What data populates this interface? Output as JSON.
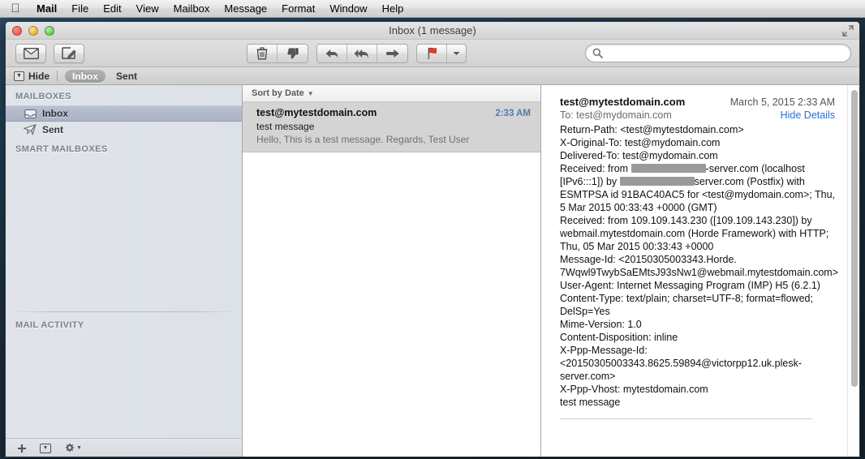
{
  "menubar": {
    "apple_icon": "apple-logo-icon",
    "items": [
      {
        "label": "Mail",
        "app": true
      },
      {
        "label": "File"
      },
      {
        "label": "Edit"
      },
      {
        "label": "View"
      },
      {
        "label": "Mailbox"
      },
      {
        "label": "Message"
      },
      {
        "label": "Format"
      },
      {
        "label": "Window"
      },
      {
        "label": "Help"
      }
    ]
  },
  "window": {
    "title": "Inbox (1 message)",
    "traffic_lights": [
      "close-button",
      "minimize-button",
      "zoom-button"
    ],
    "fullscreen_icon": "fullscreen-icon"
  },
  "toolbar": {
    "get_mail_icon": "envelope-icon",
    "compose_icon": "compose-icon",
    "delete_icon": "trash-icon",
    "junk_icon": "thumbs-down-icon",
    "reply_icon": "reply-arrow-icon",
    "reply_all_icon": "reply-all-arrow-icon",
    "forward_icon": "forward-arrow-icon",
    "flag_icon": "flag-icon",
    "flag_caret_icon": "caret-down-icon",
    "search": {
      "icon": "search-icon",
      "value": "",
      "placeholder": ""
    }
  },
  "favorites_bar": {
    "hide_label": "Hide",
    "hide_icon": "hide-panel-icon",
    "items": [
      {
        "label": "Inbox",
        "active": true
      },
      {
        "label": "Sent",
        "active": false
      }
    ]
  },
  "sidebar": {
    "sections": [
      {
        "title": "MAILBOXES",
        "items": [
          {
            "label": "Inbox",
            "icon": "inbox-tray-icon",
            "selected": true
          },
          {
            "label": "Sent",
            "icon": "paper-plane-icon",
            "selected": false
          }
        ]
      },
      {
        "title": "SMART MAILBOXES",
        "items": []
      }
    ],
    "activity_title": "MAIL ACTIVITY",
    "footer": {
      "add_icon": "plus-icon",
      "action_icon": "dropdown-box-icon",
      "settings_icon": "gear-icon",
      "settings_caret": "caret-down-icon"
    }
  },
  "message_list": {
    "sort_label": "Sort by Date",
    "sort_caret_icon": "caret-down-icon",
    "messages": [
      {
        "from": "test@mytestdomain.com",
        "time": "2:33 AM",
        "subject": "test message",
        "preview": "Hello, This is a test message. Regards, Test User",
        "selected": true
      }
    ]
  },
  "message_view": {
    "from": "test@mytestdomain.com",
    "date": "March 5, 2015  2:33 AM",
    "to_label": "To:",
    "to_value": "test@mydomain.com",
    "hide_details_label": "Hide Details",
    "header_lines": [
      {
        "text": "Return-Path: <test@mytestdomain.com>"
      },
      {
        "text": "X-Original-To: test@mydomain.com"
      },
      {
        "text": "Delivered-To: test@mydomain.com"
      },
      {
        "text": "Received: from ",
        "redact": 92,
        "after": "-server.com (localhost"
      },
      {
        "text": "[IPv6:::1]) by ",
        "redact": 92,
        "after": "server.com (Postfix) with"
      },
      {
        "text": "ESMTPSA id 91BAC40AC5 for <test@mydomain.com>; Thu,"
      },
      {
        "text": "5 Mar 2015 00:33:43 +0000 (GMT)"
      },
      {
        "text": "Received: from 109.109.143.230 ([109.109.143.230]) by"
      },
      {
        "text": "webmail.mytestdomain.com (Horde Framework) with HTTP;"
      },
      {
        "text": "Thu, 05 Mar 2015 00:33:43 +0000"
      },
      {
        "text": "Message-Id: <20150305003343.Horde."
      },
      {
        "text": "7Wqwl9TwybSaEMtsJ93sNw1@webmail.mytestdomain.com>"
      },
      {
        "text": "User-Agent: Internet Messaging Program (IMP) H5 (6.2.1)"
      },
      {
        "text": "Content-Type: text/plain; charset=UTF-8; format=flowed;"
      },
      {
        "text": "DelSp=Yes"
      },
      {
        "text": "Mime-Version: 1.0"
      },
      {
        "text": "Content-Disposition: inline"
      },
      {
        "text": "X-Ppp-Message-Id:"
      },
      {
        "text": "<20150305003343.8625.59894@victorpp12.uk.plesk-"
      },
      {
        "text": "server.com>"
      },
      {
        "text": "X-Ppp-Vhost: mytestdomain.com"
      },
      {
        "text": "test message"
      }
    ]
  },
  "colors": {
    "accent_link": "#2b6fd4",
    "time_blue": "#5378b8",
    "selected_row": "#aab3c5",
    "list_selected": "#d4d4d4",
    "redaction": "#9a9a9a"
  }
}
